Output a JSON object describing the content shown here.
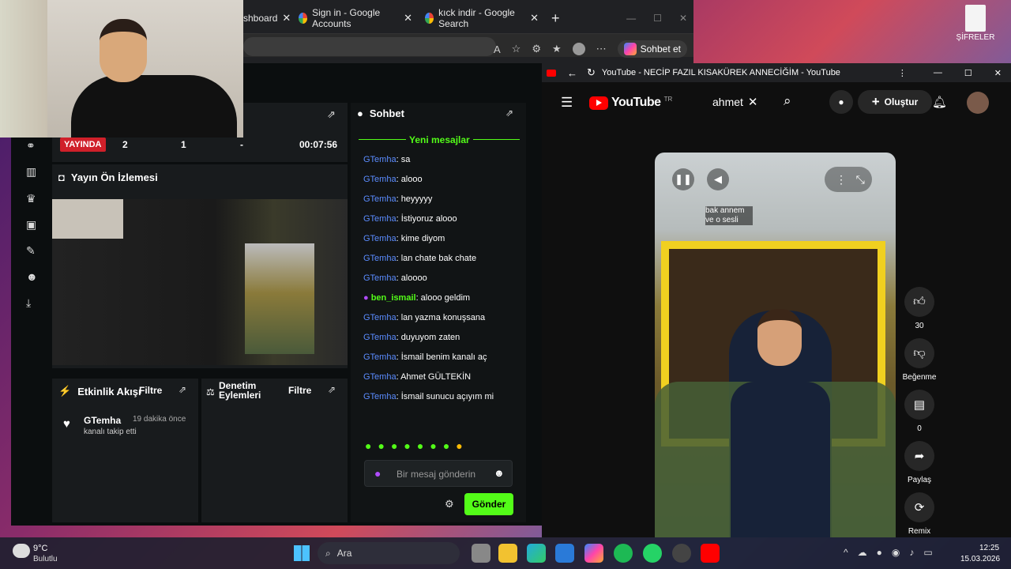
{
  "browser": {
    "tabs": [
      {
        "label": "shboard"
      },
      {
        "label": "Sign in - Google Accounts"
      },
      {
        "label": "kıck indir - Google Search"
      }
    ],
    "chat_button": "Sohbet et"
  },
  "desktop": {
    "file_icon_label": "ŞİFRELER"
  },
  "kick": {
    "live_badge": "YAYINDA",
    "stats": [
      "2",
      "1",
      "-",
      "00:07:56"
    ],
    "preview_title": "Yayın Ön İzlemesi",
    "activity_title": "Etkinlik Akışı",
    "activity_filter": "Filtre",
    "mod_title": "Denetim Eylemleri",
    "mod_filter": "Filtre",
    "activity_item": {
      "user": "GTemha",
      "time": "19 dakika önce",
      "text": "kanalı takip etti"
    },
    "chat_title": "Sohbet",
    "new_messages": "Yeni mesajlar",
    "messages": [
      {
        "user": "GTemha",
        "text": ": sa"
      },
      {
        "user": "GTemha",
        "text": ": alooo"
      },
      {
        "user": "GTemha",
        "text": ": heyyyyy"
      },
      {
        "user": "GTemha",
        "text": ": İstiyoruz alooo"
      },
      {
        "user": "GTemha",
        "text": ": kime diyom"
      },
      {
        "user": "GTemha",
        "text": ": lan chate bak chate"
      },
      {
        "user": "GTemha",
        "text": ": aloooo"
      },
      {
        "user": "ben_ismail",
        "text": ": alooo geldim"
      },
      {
        "user": "GTemha",
        "text": ": lan yazma konuşsana"
      },
      {
        "user": "GTemha",
        "text": ": duyuyom zaten"
      },
      {
        "user": "GTemha",
        "text": ": İsmail benim kanalı aç"
      },
      {
        "user": "GTemha",
        "text": ": Ahmet GÜLTEKİN"
      },
      {
        "user": "GTemha",
        "text": ": İsmail sunucu açıyım mi"
      }
    ],
    "chat_placeholder": "Bir mesaj gönderin",
    "send_button": "Gönder"
  },
  "youtube": {
    "window_title": "YouTube - NECİP FAZIL KISAKÜREK ANNECİĞİM - YouTube",
    "logo": "YouTube",
    "region": "TR",
    "search_value": "ahmet",
    "create_button": "Oluştur",
    "caption": "bak annem ve o sesli",
    "likes": "30",
    "dislike_label": "Beğenme",
    "comments": "0",
    "share_label": "Paylaş",
    "remix_label": "Remix"
  },
  "taskbar": {
    "weather_temp": "9°C",
    "weather_desc": "Bulutlu",
    "search_label": "Ara",
    "time": "12:25",
    "date": "15.03.2026"
  },
  "colors": {
    "kick_green": "#53fc18",
    "youtube_red": "#ff0000",
    "live_red": "#d0202a"
  }
}
